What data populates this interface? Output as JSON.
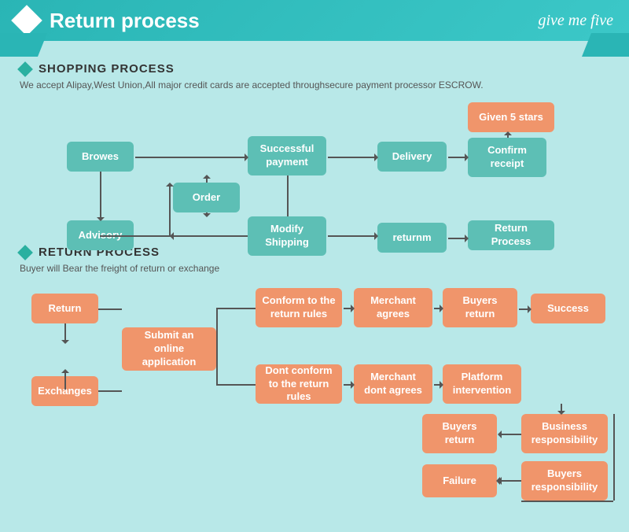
{
  "header": {
    "title": "Return process",
    "logo": "give me five"
  },
  "shopping_section": {
    "title": "SHOPPING PROCESS",
    "subtitle": "We accept Alipay,West Union,All major credit cards are accepted throughsecure payment processor ESCROW.",
    "boxes": {
      "browes": "Browes",
      "order": "Order",
      "advisory": "Advisory",
      "modify_shipping": "Modify Shipping",
      "successful_payment": "Successful payment",
      "delivery": "Delivery",
      "confirm_receipt": "Confirm receipt",
      "given_5_stars": "Given 5 stars",
      "returnm": "returnm",
      "return_process": "Return Process"
    }
  },
  "return_section": {
    "title": "RETURN PROCESS",
    "subtitle": "Buyer will Bear the freight of return or exchange",
    "boxes": {
      "return_btn": "Return",
      "exchanges": "Exchanges",
      "submit_online": "Submit an online application",
      "conform_rules": "Conform to the return rules",
      "dont_conform": "Dont conform to the return rules",
      "merchant_agrees": "Merchant agrees",
      "merchant_dont": "Merchant dont agrees",
      "buyers_return1": "Buyers return",
      "buyers_return2": "Buyers return",
      "platform": "Platform intervention",
      "success": "Success",
      "business_resp": "Business responsibility",
      "buyers_resp": "Buyers responsibility",
      "failure": "Failure"
    }
  }
}
